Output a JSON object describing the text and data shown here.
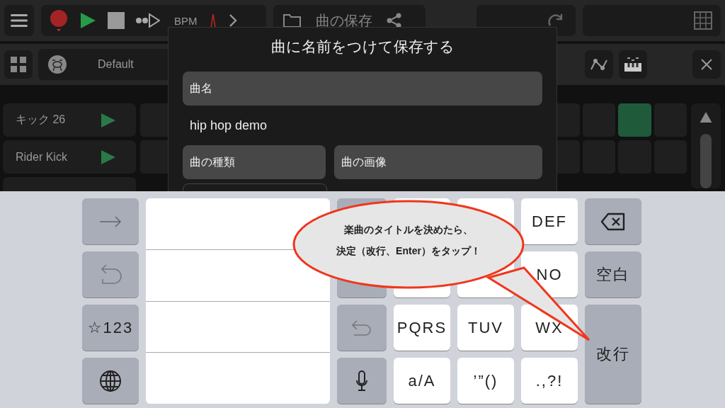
{
  "toolbar": {
    "bpm_label": "BPM",
    "file_title": "曲の保存"
  },
  "kit_bar": {
    "kit_name": "Default"
  },
  "tracks": [
    {
      "name": "キック 26",
      "pads": [
        false,
        false,
        false,
        true,
        false
      ]
    },
    {
      "name": "Rider Kick",
      "pads": [
        false,
        false,
        false,
        false,
        false
      ]
    }
  ],
  "dialog": {
    "title": "曲に名前をつけて保存する",
    "name_label": "曲名",
    "name_value": "hip hop demo",
    "buttons": [
      "曲の種類",
      "曲の画像"
    ]
  },
  "keyboard": {
    "left": [
      {
        "kind": "arrow"
      },
      {
        "kind": "undo"
      },
      {
        "kind": "text",
        "label": "☆123"
      },
      {
        "kind": "globe"
      }
    ],
    "rows": [
      [
        {
          "kind": "blank"
        },
        {
          "kind": "blank"
        },
        {
          "kind": "blank"
        },
        {
          "kind": "text",
          "label": "DEF"
        }
      ],
      [
        {
          "kind": "blank"
        },
        {
          "kind": "blank"
        },
        {
          "kind": "blank"
        },
        {
          "kind": "text",
          "label": "NO"
        }
      ],
      [
        {
          "kind": "return-arrow"
        },
        {
          "kind": "text",
          "label": "PQRS"
        },
        {
          "kind": "text",
          "label": "TUV"
        },
        {
          "kind": "text",
          "label": "WX"
        }
      ],
      [
        {
          "kind": "mic"
        },
        {
          "kind": "text",
          "label": "a/A"
        },
        {
          "kind": "text",
          "label": "’”()"
        },
        {
          "kind": "text",
          "label": ".,?!"
        }
      ]
    ],
    "right": [
      {
        "kind": "backspace"
      },
      {
        "kind": "text",
        "label": "空白"
      },
      {
        "kind": "text",
        "label": "改行"
      }
    ]
  },
  "callout": {
    "lines": [
      "楽曲のタイトルを決めたら、",
      "決定（改行、Enter）をタップ！"
    ]
  }
}
